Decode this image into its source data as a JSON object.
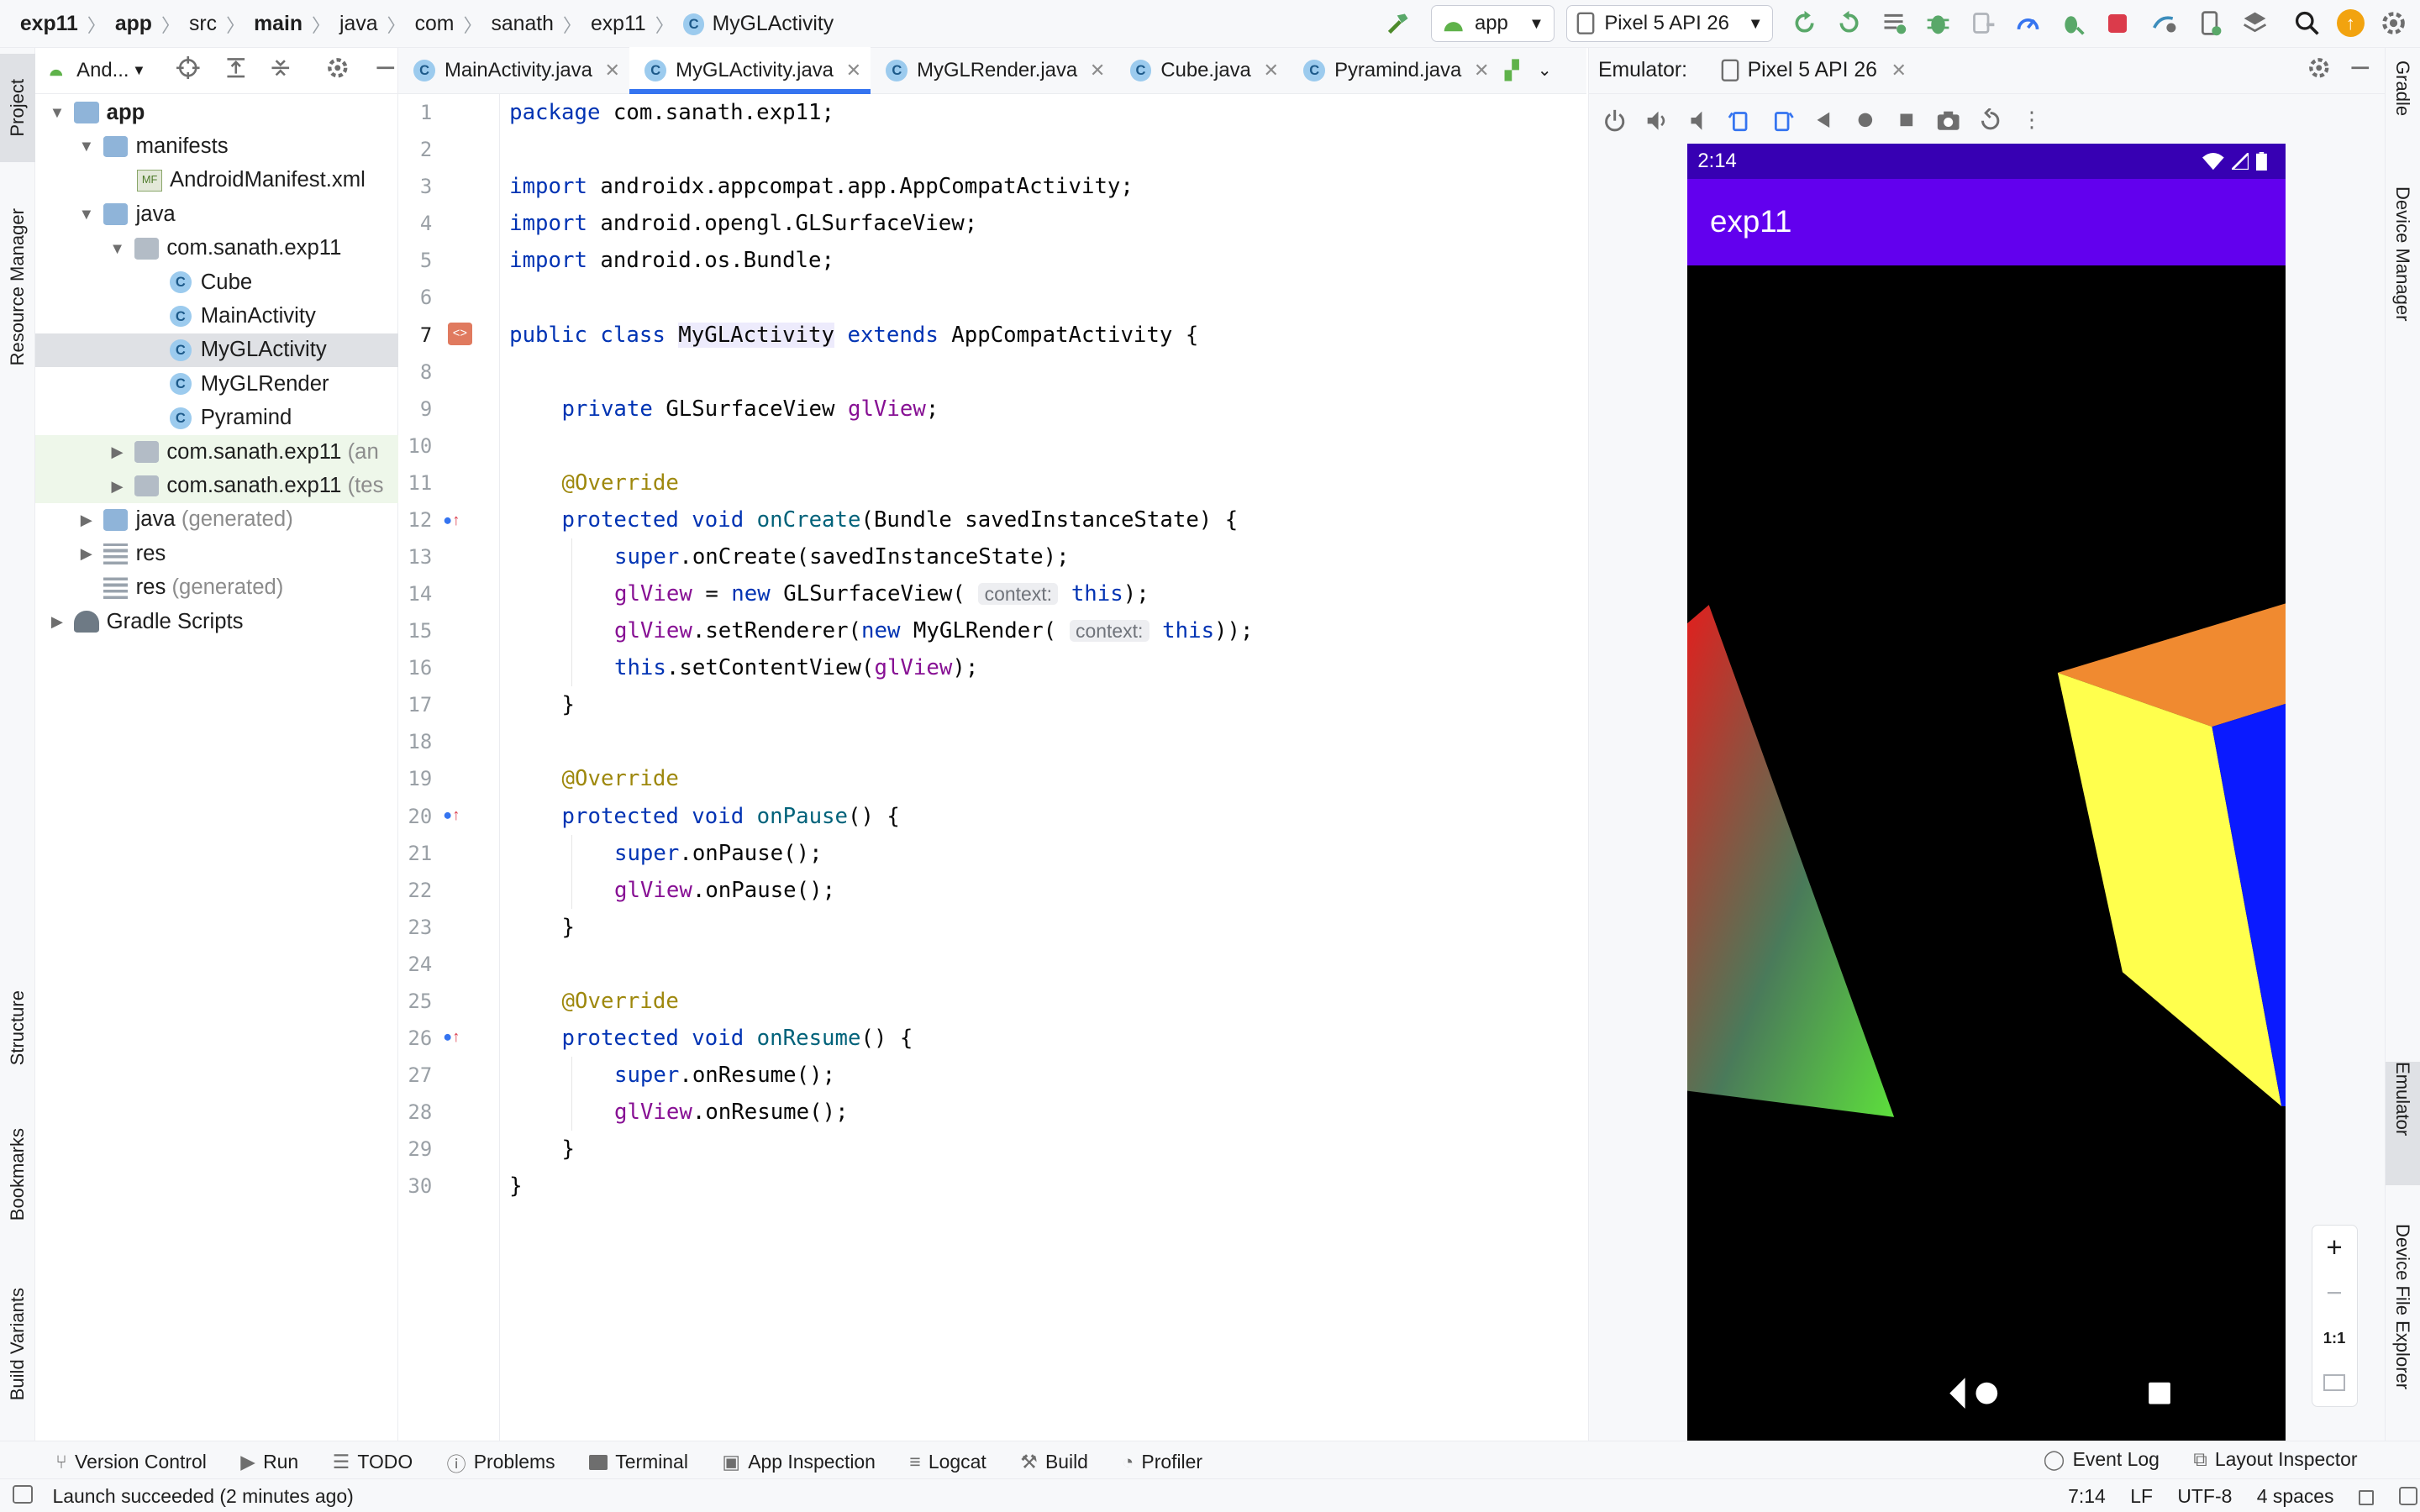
{
  "breadcrumb": [
    "exp11",
    "app",
    "src",
    "main",
    "java",
    "com",
    "sanath",
    "exp11",
    "MyGLActivity"
  ],
  "run_config": "app",
  "device_selector": "Pixel 5 API 26",
  "left_stripe": {
    "project": "Project",
    "resource_manager": "Resource Manager",
    "structure": "Structure",
    "bookmarks": "Bookmarks",
    "build_variants": "Build Variants"
  },
  "right_stripe": {
    "gradle": "Gradle",
    "device_manager": "Device Manager",
    "emulator": "Emulator",
    "device_file_explorer": "Device File Explorer"
  },
  "project_panel": {
    "view_mode": "And...",
    "tree": [
      {
        "label": "app",
        "extra": ""
      },
      {
        "label": "manifests",
        "extra": ""
      },
      {
        "label": "AndroidManifest.xml",
        "extra": ""
      },
      {
        "label": "java",
        "extra": ""
      },
      {
        "label": "com.sanath.exp11",
        "extra": ""
      },
      {
        "label": "Cube",
        "extra": ""
      },
      {
        "label": "MainActivity",
        "extra": ""
      },
      {
        "label": "MyGLActivity",
        "extra": ""
      },
      {
        "label": "MyGLRender",
        "extra": ""
      },
      {
        "label": "Pyramind",
        "extra": ""
      },
      {
        "label": "com.sanath.exp11",
        "extra": "(an"
      },
      {
        "label": "com.sanath.exp11",
        "extra": "(tes"
      },
      {
        "label": "java",
        "extra": "(generated)"
      },
      {
        "label": "res",
        "extra": ""
      },
      {
        "label": "res",
        "extra": "(generated)"
      },
      {
        "label": "Gradle Scripts",
        "extra": ""
      }
    ]
  },
  "editor_tabs": [
    "MainActivity.java",
    "MyGLActivity.java",
    "MyGLRender.java",
    "Cube.java",
    "Pyramind.java"
  ],
  "code": {
    "line_numbers": [
      "1",
      "2",
      "3",
      "4",
      "5",
      "6",
      "7",
      "8",
      "9",
      "10",
      "11",
      "12",
      "13",
      "14",
      "15",
      "16",
      "17",
      "18",
      "19",
      "20",
      "21",
      "22",
      "23",
      "24",
      "25",
      "26",
      "27",
      "28",
      "29",
      "30"
    ],
    "l1": {
      "kw": "package",
      "rest": " com.sanath.exp11;"
    },
    "l3": {
      "kw": "import",
      "rest": " androidx.appcompat.app.AppCompatActivity;"
    },
    "l4": {
      "kw": "import",
      "rest": " android.opengl.GLSurfaceView;"
    },
    "l5": {
      "kw": "import",
      "rest": " android.os.Bundle;"
    },
    "l7": {
      "kw1": "public class",
      "name": "MyGLActivity",
      "kw2": "extends",
      "rest": " AppCompatActivity {"
    },
    "l9": {
      "kw": "private",
      "type": " GLSurfaceView ",
      "field": "glView",
      "rest": ";"
    },
    "override": "@Override",
    "l12": {
      "kw": "protected void",
      "fn": "onCreate",
      "rest": "(Bundle savedInstanceState) {"
    },
    "l13": {
      "kw": "super",
      "rest": ".onCreate(savedInstanceState);"
    },
    "l14": {
      "field": "glView",
      "eq": " = ",
      "kw": "new",
      "cls": " GLSurfaceView(",
      "hint": "context:",
      "kw2": "this",
      "rest": ");"
    },
    "l15": {
      "field": "glView",
      "mid": ".setRenderer(",
      "kw": "new",
      "cls": " MyGLRender(",
      "hint": "context:",
      "kw2": "this",
      "rest": "));"
    },
    "l16": {
      "kw": "this",
      "mid": ".setContentView(",
      "field": "glView",
      "rest": ");"
    },
    "brace": "}",
    "l20": {
      "kw": "protected void",
      "fn": "onPause",
      "rest": "() {"
    },
    "l21": {
      "kw": "super",
      "rest": ".onPause();"
    },
    "l22": {
      "field": "glView",
      "rest": ".onPause();"
    },
    "l26": {
      "kw": "protected void",
      "fn": "onResume",
      "rest": "() {"
    },
    "l27": {
      "kw": "super",
      "rest": ".onResume();"
    },
    "l28": {
      "field": "glView",
      "rest": ".onResume();"
    }
  },
  "emulator": {
    "label": "Emulator:",
    "device_tab": "Pixel 5 API 26",
    "time": "2:14",
    "app_title": "exp11",
    "zoom_ratio": "1:1"
  },
  "bottom_tools": [
    "Version Control",
    "Run",
    "TODO",
    "Problems",
    "Terminal",
    "App Inspection",
    "Logcat",
    "Build",
    "Profiler"
  ],
  "bottom_right_tools": [
    "Event Log",
    "Layout Inspector"
  ],
  "status": {
    "message": "Launch succeeded (2 minutes ago)",
    "position": "7:14",
    "line_sep": "LF",
    "encoding": "UTF-8",
    "indent": "4 spaces"
  },
  "colors": {
    "keyword": "#0033b3",
    "field": "#871094",
    "annotation": "#9e880d",
    "function": "#00627a",
    "app_bar": "#6200ee",
    "status_bar": "#3700b3",
    "accent": "#3574f0"
  }
}
